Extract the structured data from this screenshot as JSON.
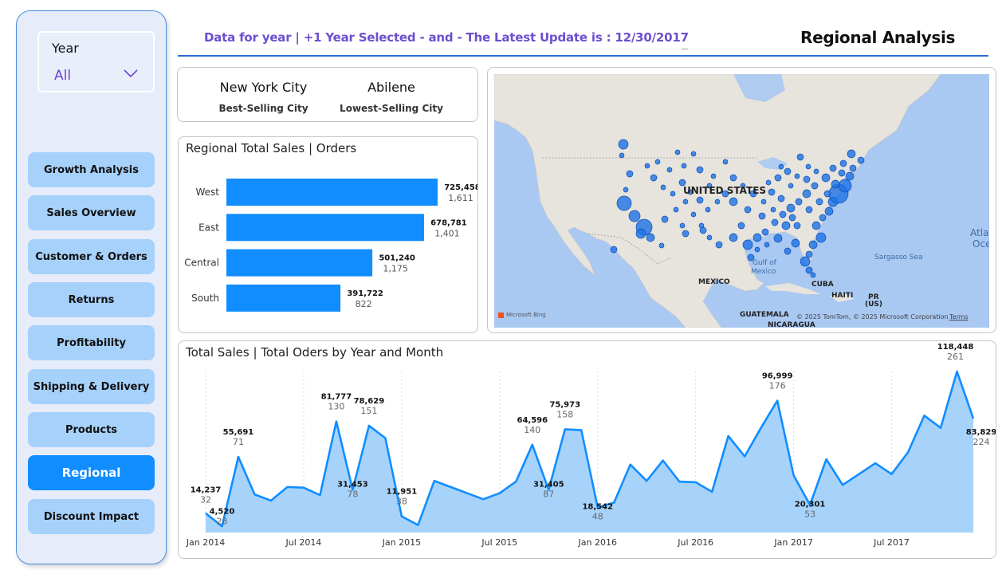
{
  "sidebar": {
    "slicer": {
      "title": "Year",
      "value": "All"
    },
    "nav": [
      {
        "label": "Growth Analysis",
        "active": false
      },
      {
        "label": "Sales Overview",
        "active": false
      },
      {
        "label": "Customer & Orders",
        "active": false
      },
      {
        "label": "Returns",
        "active": false
      },
      {
        "label": "Profitability",
        "active": false
      },
      {
        "label": "Shipping & Delivery",
        "active": false
      },
      {
        "label": "Products",
        "active": false
      },
      {
        "label": "Regional",
        "active": true
      },
      {
        "label": "Discount Impact",
        "active": false
      }
    ]
  },
  "header": {
    "subtitle": "Data for year | +1 Year Selected - and - The Latest Update is : 12/30/2017",
    "title": "Regional Analysis"
  },
  "kpi": {
    "best_city": "New York City",
    "best_label": "Best-Selling City",
    "lowest_city": "Abilene",
    "lowest_label": "Lowest-Selling City"
  },
  "map": {
    "labels": {
      "country": "UNITED STATES",
      "mexico": "MEXICO",
      "gulf": "Gulf of",
      "gulf2": "Mexico",
      "cuba": "CUBA",
      "haiti": "HAITI",
      "pr": "PR",
      "pr2": "(US)",
      "sargasso": "Sargasso Sea",
      "atlantic": "Atlan",
      "atlantic2": "Oce",
      "guatemala": "GUATEMALA",
      "nicaragua": "NICARAGUA"
    },
    "bing": "Microsoft Bing",
    "credit": "© 2025 TomTom, © 2025 Microsoft Corporation",
    "terms": "Terms"
  },
  "regional_chart": {
    "title": "Regional Total Sales | Orders",
    "chart_data": {
      "type": "bar",
      "categories": [
        "West",
        "East",
        "Central",
        "South"
      ],
      "series": [
        {
          "name": "Total Sales",
          "values": [
            725458,
            678781,
            501240,
            391722
          ]
        },
        {
          "name": "Orders",
          "values": [
            1611,
            1401,
            1175,
            822
          ]
        }
      ],
      "sales_labels": [
        "725,458",
        "678,781",
        "501,240",
        "391,722"
      ],
      "order_labels": [
        "1,611",
        "1,401",
        "1,175",
        "822"
      ]
    }
  },
  "trend_chart": {
    "title": "Total Sales | Total Oders by Year and Month",
    "chart_data": {
      "type": "area",
      "x_ticks": [
        "Jan 2014",
        "Jul 2014",
        "Jan 2015",
        "Jul 2015",
        "Jan 2016",
        "Jul 2016",
        "Jan 2017",
        "Jul 2017"
      ],
      "tick_months": [
        0,
        6,
        12,
        18,
        24,
        30,
        36,
        42
      ],
      "sales": [
        14237,
        4520,
        55691,
        28000,
        23500,
        33500,
        33000,
        27500,
        81777,
        31453,
        78629,
        69500,
        11951,
        5500,
        38000,
        33500,
        29000,
        24500,
        29000,
        37500,
        64596,
        31405,
        75973,
        75300,
        18542,
        22000,
        50000,
        38000,
        53000,
        37500,
        37000,
        30000,
        71000,
        56000,
        77000,
        96999,
        42000,
        20301,
        54000,
        35000,
        43000,
        51000,
        43000,
        59000,
        86000,
        77000,
        118448,
        83829
      ],
      "annotations": [
        {
          "m": 0,
          "sales": "14,237",
          "orders": "32"
        },
        {
          "m": 1,
          "sales": "4,520",
          "orders": "28"
        },
        {
          "m": 2,
          "sales": "55,691",
          "orders": "71"
        },
        {
          "m": 8,
          "sales": "81,777",
          "orders": "130"
        },
        {
          "m": 9,
          "sales": "31,453",
          "orders": "78"
        },
        {
          "m": 10,
          "sales": "78,629",
          "orders": "151"
        },
        {
          "m": 12,
          "sales": "11,951",
          "orders": "38"
        },
        {
          "m": 20,
          "sales": "64,596",
          "orders": "140"
        },
        {
          "m": 21,
          "sales": "31,405",
          "orders": "87"
        },
        {
          "m": 22,
          "sales": "75,973",
          "orders": "158"
        },
        {
          "m": 24,
          "sales": "18,542",
          "orders": "48"
        },
        {
          "m": 35,
          "sales": "96,999",
          "orders": "176"
        },
        {
          "m": 37,
          "sales": "20,301",
          "orders": "53"
        },
        {
          "m": 46,
          "sales": "118,448",
          "orders": "261"
        },
        {
          "m": 47,
          "sales": "83,829",
          "orders": "224"
        }
      ]
    }
  },
  "colors": {
    "accent": "#118dff",
    "nav": "#a6d1fb",
    "header": "#6b4fcf",
    "area": "#a7d3fb"
  }
}
